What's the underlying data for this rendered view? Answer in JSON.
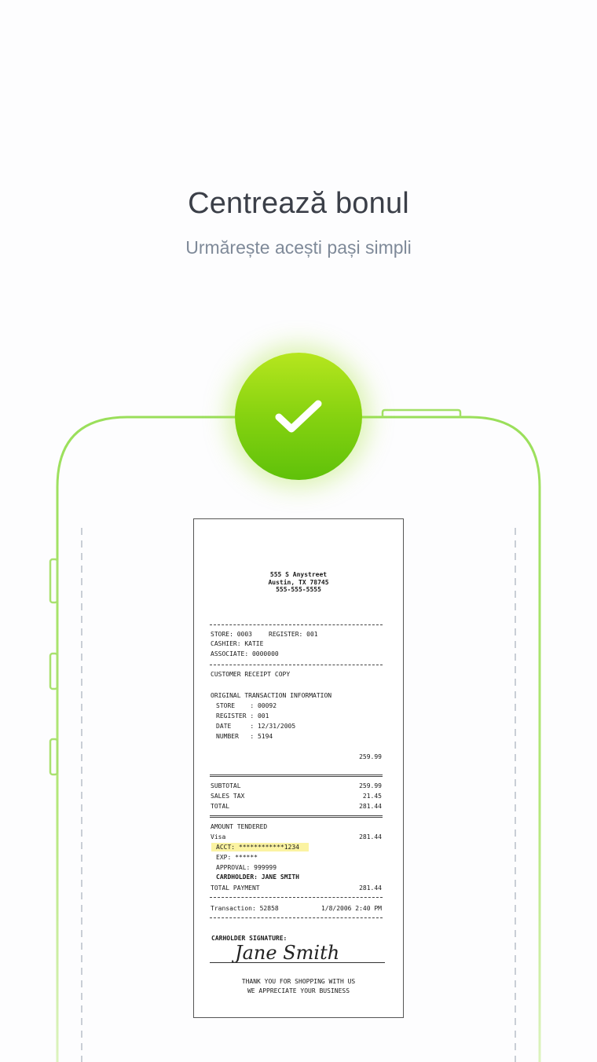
{
  "header": {
    "title": "Centrează bonul",
    "subtitle": "Urmărește acești pași simpli"
  },
  "colors": {
    "accent_green": "#7dcf12",
    "outline_green": "#9ee060",
    "title": "#3b3f48",
    "subtitle": "#7f8a99"
  },
  "check_button": {
    "icon": "checkmark-icon"
  },
  "receipt": {
    "address": [
      "555 S Anystreet",
      "Austin, TX 78745",
      "555-555-5555"
    ],
    "store_line": "STORE: 0003",
    "register_line": "REGISTER: 001",
    "cashier": "CASHIER: KATIE",
    "associate": "ASSOCIATE: 0000000",
    "copy_label": "CUSTOMER RECEIPT COPY",
    "orig_header": "ORIGINAL TRANSACTION INFORMATION",
    "orig_store": "STORE    : 00092",
    "orig_register": "REGISTER : 001",
    "orig_date": "DATE     : 12/31/2005",
    "orig_number": "NUMBER   : 5194",
    "item_amount": "259.99",
    "subtotal_label": "SUBTOTAL",
    "subtotal": "259.99",
    "tax_label": "SALES TAX",
    "tax": "21.45",
    "total_label": "TOTAL",
    "total": "281.44",
    "tendered_label": "AMOUNT TENDERED",
    "card_type": "Visa",
    "card_amount": "281.44",
    "acct": "ACCT: ************1234",
    "exp": "EXP: ******",
    "approval": "APPROVAL: 999999",
    "cardholder": "CARDHOLDER: JANE SMITH",
    "payment_label": "TOTAL PAYMENT",
    "payment": "281.44",
    "transaction": "Transaction: 52858",
    "datetime": "1/8/2006 2:40 PM",
    "signature_label": "CARHOLDER SIGNATURE:",
    "signature": "Jane Smith",
    "thanks_1": "THANK YOU FOR SHOPPING WITH US",
    "thanks_2": "WE APPRECIATE YOUR BUSINESS"
  }
}
